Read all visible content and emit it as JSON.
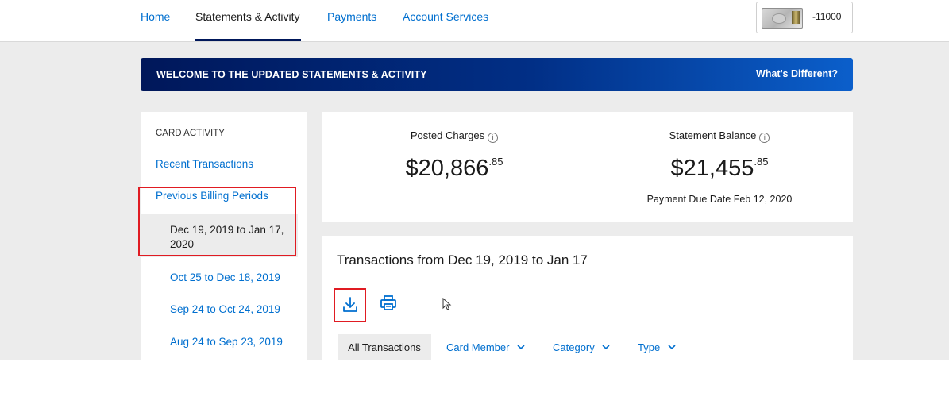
{
  "nav": {
    "items": [
      "Home",
      "Statements & Activity",
      "Payments",
      "Account Services"
    ],
    "active": "Statements & Activity",
    "card_number": "-11000"
  },
  "banner": {
    "title": "WELCOME TO THE UPDATED STATEMENTS & ACTIVITY",
    "link": "What's Different?"
  },
  "sidebar": {
    "heading": "CARD ACTIVITY",
    "recent": "Recent Transactions",
    "previous": "Previous Billing Periods",
    "selected_period": "Dec 19, 2019 to Jan 17, 2020",
    "periods": [
      "Oct 25 to Dec 18, 2019",
      "Sep 24 to Oct 24, 2019",
      "Aug 24 to Sep 23, 2019"
    ]
  },
  "summary": {
    "posted_label": "Posted Charges",
    "posted_dollars": "$20,866",
    "posted_cents": ".85",
    "statement_label": "Statement Balance",
    "statement_dollars": "$21,455",
    "statement_cents": ".85",
    "due_date": "Payment Due Date Feb 12, 2020"
  },
  "transactions": {
    "title": "Transactions from Dec 19, 2019 to Jan 17",
    "filters": [
      "All Transactions",
      "Card Member",
      "Category",
      "Type"
    ]
  },
  "colors": {
    "link_blue": "#006fcf",
    "navy": "#00175a",
    "highlight_red": "#e01b22",
    "page_gray": "#ececec"
  },
  "icons": [
    "download-icon",
    "print-icon",
    "info-icon",
    "chevron-down-icon",
    "mouse-cursor-icon",
    "amex-card-icon"
  ]
}
